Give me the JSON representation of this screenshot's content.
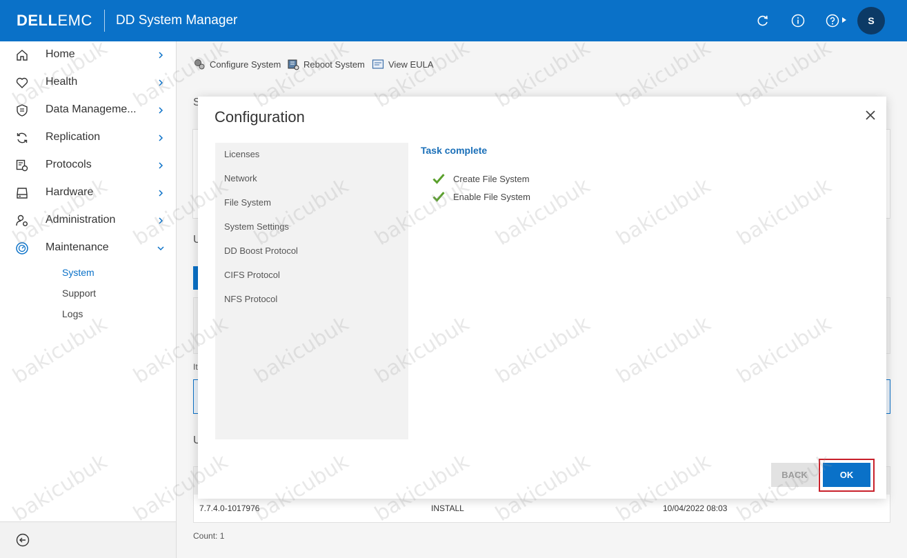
{
  "header": {
    "brand_dell": "DELL",
    "brand_emc": "EMC",
    "app_title": "DD System Manager",
    "avatar_initial": "S"
  },
  "sidebar": {
    "items": [
      {
        "label": "Home",
        "icon": "home-icon"
      },
      {
        "label": "Health",
        "icon": "heart-icon"
      },
      {
        "label": "Data Manageme...",
        "icon": "shield-icon"
      },
      {
        "label": "Replication",
        "icon": "sync-icon"
      },
      {
        "label": "Protocols",
        "icon": "protocols-icon"
      },
      {
        "label": "Hardware",
        "icon": "drive-icon"
      },
      {
        "label": "Administration",
        "icon": "admin-icon"
      },
      {
        "label": "Maintenance",
        "icon": "maintenance-icon"
      }
    ],
    "subitems": [
      "System",
      "Support",
      "Logs"
    ]
  },
  "toolbar": {
    "configure": "Configure System",
    "reboot": "Reboot System",
    "eula": "View EULA"
  },
  "background": {
    "letter1": "S",
    "letter2": "U",
    "letter3": "U",
    "it_text": "It",
    "row_version": "7.7.4.0-1017976",
    "row_action": "INSTALL",
    "row_date": "10/04/2022 08:03",
    "count": "Count: 1"
  },
  "modal": {
    "title": "Configuration",
    "steps": [
      "Licenses",
      "Network",
      "File System",
      "System Settings",
      "DD Boost Protocol",
      "CIFS Protocol",
      "NFS Protocol"
    ],
    "task_title": "Task complete",
    "tasks": [
      "Create File System",
      "Enable File System"
    ],
    "back_label": "BACK",
    "ok_label": "OK"
  },
  "colors": {
    "header": "#0a71c8",
    "accent": "#0a71c8",
    "highlight": "#c8202a"
  },
  "watermark": "bakicubuk"
}
